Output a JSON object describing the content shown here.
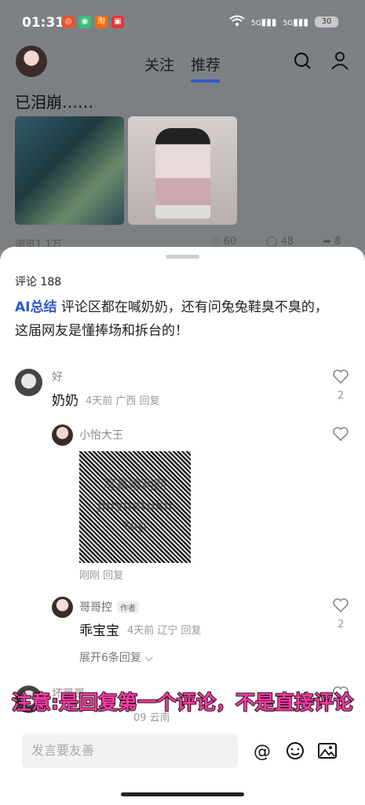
{
  "status": {
    "time": "01:31",
    "battery": "30",
    "net1": "5G",
    "net2": "5G"
  },
  "nav": {
    "tab_follow": "关注",
    "tab_recommend": "推荐"
  },
  "post": {
    "text": "已泪崩……",
    "views": "浏览1.1万",
    "likes": "60",
    "comments": "48",
    "shares": "8"
  },
  "comments": {
    "count_label": "评论 188",
    "ai_label": "AI总结",
    "ai_text": "评论区都在喊奶奶，还有问兔兔鞋臭不臭的，这届网友是懂捧场和拆台的！",
    "items": [
      {
        "name": "好",
        "text": "奶奶",
        "meta": "4天前 广西 回复",
        "likes": "2"
      },
      {
        "name": "小怡大王",
        "watermark": "写真福利网\njiuyuetuku\ntop",
        "meta": "刚刚 回复"
      },
      {
        "name": "哥哥控",
        "tag": "作者",
        "text": "乖宝宝",
        "meta": "4天前 辽宁 回复",
        "likes": "2"
      },
      {
        "name": "坏哥哥",
        "meta": "09 云南"
      }
    ],
    "expand": "展开6条回复"
  },
  "overlay": {
    "text": "注意:是回复第一个评论，不是直接评论"
  },
  "input": {
    "placeholder": "发言要友善"
  },
  "colors": {
    "accent": "#2f5ac9",
    "overlay": "#ff3aa5"
  }
}
